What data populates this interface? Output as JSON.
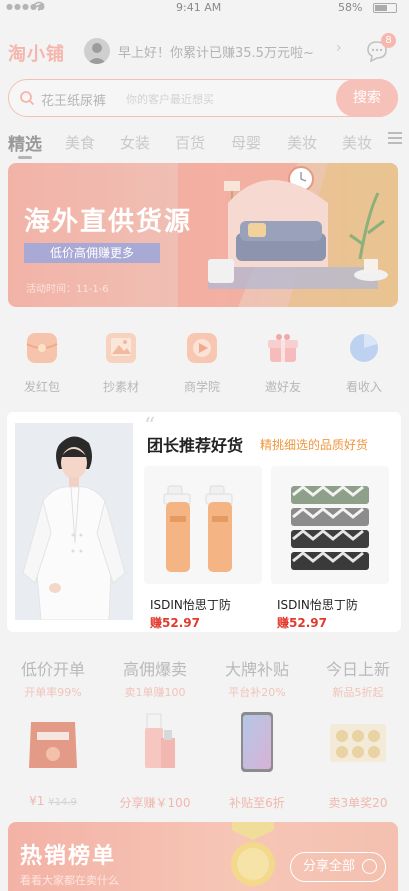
{
  "status_bar": {
    "time": "9:41 AM",
    "battery": "58%"
  },
  "header": {
    "logo": "淘小铺",
    "greeting": "早上好！你累计已赚35.5万元啦~",
    "message_badge": "8"
  },
  "search": {
    "keyword": "花王纸尿裤",
    "placeholder": "你的客户最近想买",
    "button": "搜索"
  },
  "tabs": [
    "精选",
    "美食",
    "女装",
    "百货",
    "母婴",
    "美妆",
    "美妆"
  ],
  "banner": {
    "title": "海外直供货源",
    "subtitle": "低价高佣赚更多",
    "date": "活动时间：11-1-6"
  },
  "quick_actions": [
    {
      "label": "发红包",
      "icon": "red-packet-icon",
      "color": "#f6c4ad"
    },
    {
      "label": "抄素材",
      "icon": "image-material-icon",
      "color": "#f7d2bf"
    },
    {
      "label": "商学院",
      "icon": "play-video-icon",
      "color": "#f7c7b1"
    },
    {
      "label": "邀好友",
      "icon": "gift-box-icon",
      "color": "#f6bcbb"
    },
    {
      "label": "看收入",
      "icon": "pie-chart-icon",
      "color": "#bcd2f0"
    }
  ],
  "featured": {
    "title": "团长推荐好货",
    "subtitle": "精挑细选的品质好货",
    "products": [
      {
        "name": "ISDIN怡思丁防",
        "price": "赚52.97"
      },
      {
        "name": "ISDIN怡思丁防",
        "price": "赚52.97"
      }
    ]
  },
  "deals": [
    {
      "title": "低价开单",
      "sub": "开单率99%",
      "price": "¥1",
      "old": "¥14.9"
    },
    {
      "title": "高佣爆卖",
      "sub": "卖1单赚100",
      "price": "分享赚￥100",
      "old": ""
    },
    {
      "title": "大牌补贴",
      "sub": "平台补20%",
      "price": "补贴至6折",
      "old": ""
    },
    {
      "title": "今日上新",
      "sub": "新品5折起",
      "price": "卖3单奖20",
      "old": ""
    }
  ],
  "hot_list": {
    "title": "热销榜单",
    "subtitle": "看看大家都在卖什么",
    "share": "分享全部"
  }
}
